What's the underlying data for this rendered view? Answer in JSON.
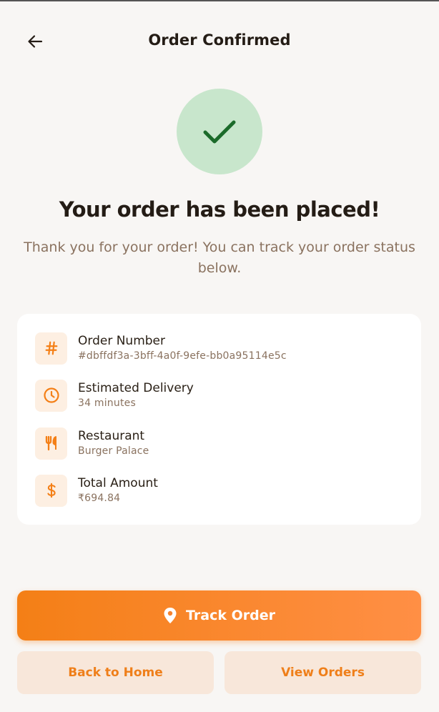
{
  "header": {
    "title": "Order Confirmed"
  },
  "confirmation": {
    "headline": "Your order has been placed!",
    "message": "Thank you for your order! You can track your order status below."
  },
  "details": [
    {
      "icon": "hash-icon",
      "label": "Order Number",
      "value": "#dbffdf3a-3bff-4a0f-9efe-bb0a95114e5c"
    },
    {
      "icon": "clock-icon",
      "label": "Estimated Delivery",
      "value": "34 minutes"
    },
    {
      "icon": "fork-knife-icon",
      "label": "Restaurant",
      "value": "Burger Palace"
    },
    {
      "icon": "dollar-icon",
      "label": "Total Amount",
      "value": "₹694.84"
    }
  ],
  "actions": {
    "track_label": "Track Order",
    "home_label": "Back to Home",
    "orders_label": "View Orders"
  },
  "colors": {
    "accent": "#f47f16",
    "success_bg": "#c8e6cc",
    "success_check": "#1b6b2a",
    "icon_bg": "#fdefe2",
    "secondary_button_bg": "#f8e7da"
  }
}
